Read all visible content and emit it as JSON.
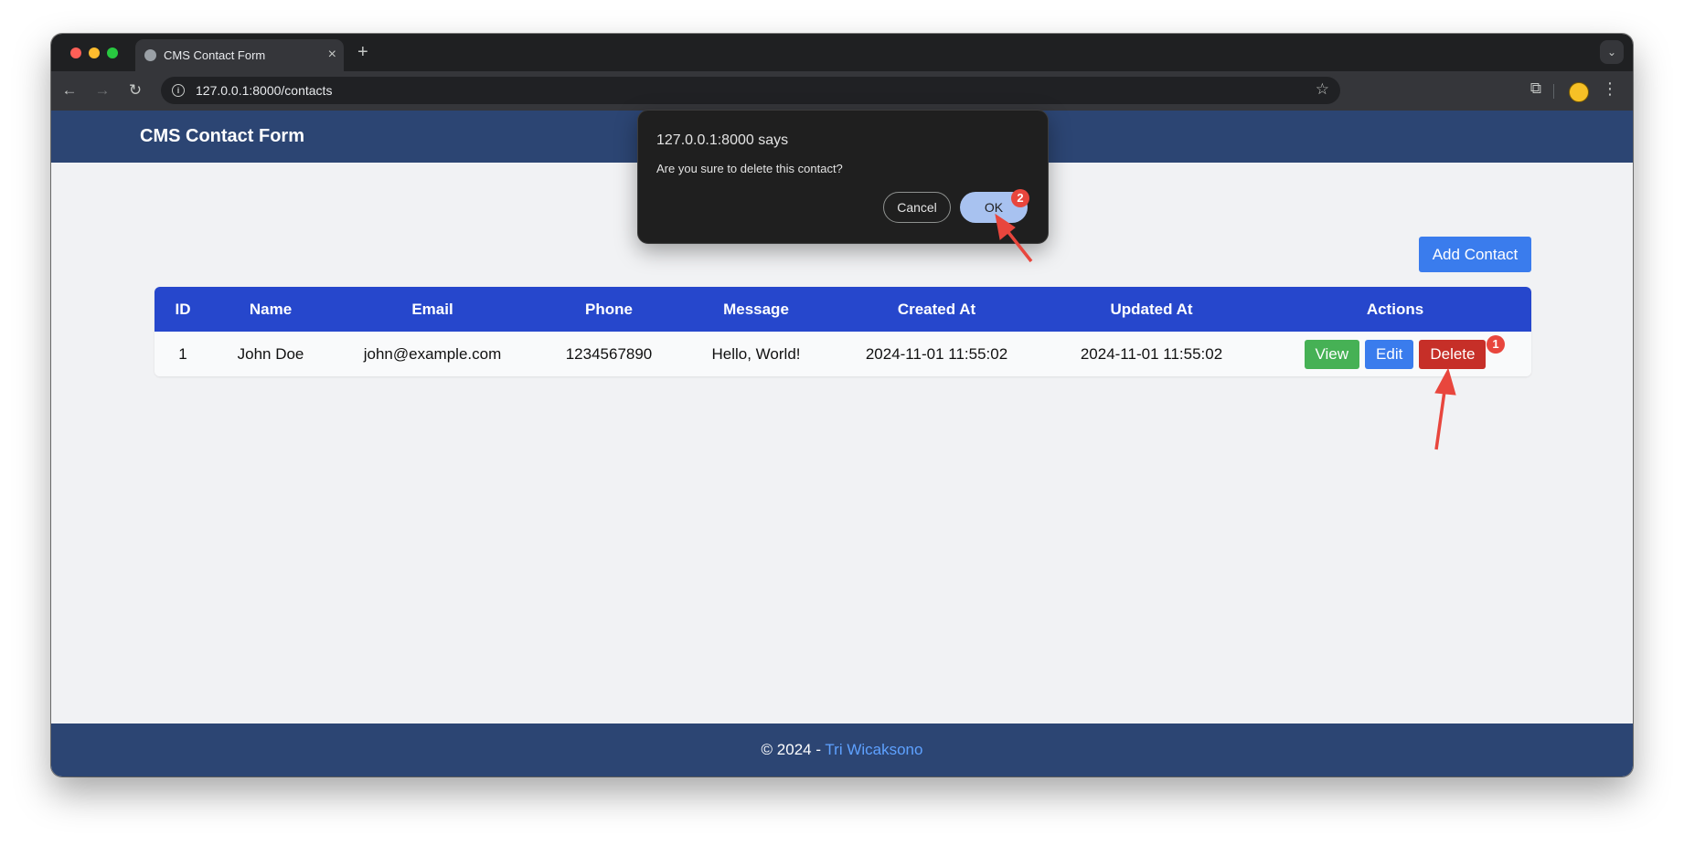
{
  "browser": {
    "tab_title": "CMS Contact Form",
    "tab_close": "×",
    "new_tab": "+",
    "url": "127.0.0.1:8000/contacts"
  },
  "app": {
    "title": "CMS Contact Form",
    "add_contact_label": "Add Contact"
  },
  "table": {
    "columns": [
      "ID",
      "Name",
      "Email",
      "Phone",
      "Message",
      "Created At",
      "Updated At",
      "Actions"
    ],
    "rows": [
      {
        "id": "1",
        "name": "John Doe",
        "email": "john@example.com",
        "phone": "1234567890",
        "message": "Hello, World!",
        "created_at": "2024-11-01 11:55:02",
        "updated_at": "2024-11-01 11:55:02",
        "actions": {
          "view": "View",
          "edit": "Edit",
          "delete": "Delete"
        }
      }
    ]
  },
  "footer": {
    "prefix": "© 2024 - ",
    "author": "Tri Wicaksono"
  },
  "dialog": {
    "title": "127.0.0.1:8000 says",
    "message": "Are you sure to delete this contact?",
    "cancel_label": "Cancel",
    "ok_label": "OK"
  },
  "annotations": {
    "badge_1": "1",
    "badge_2": "2",
    "color": "#e8463d"
  },
  "colors": {
    "header_bg": "#2c4573",
    "table_header_bg": "#2647cc",
    "primary": "#3a7ced",
    "success": "#46b155",
    "danger": "#c62f28"
  }
}
